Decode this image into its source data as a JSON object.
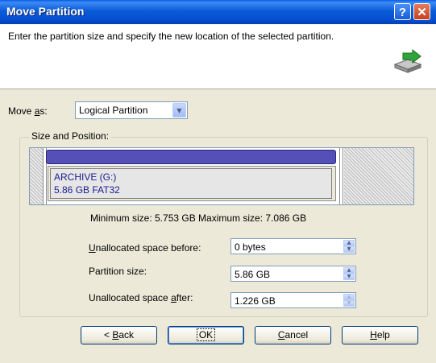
{
  "window": {
    "title": "Move Partition",
    "help_btn": "?",
    "close_btn": "✕"
  },
  "header": {
    "text": "Enter the partition size and specify the new location of the selected partition.",
    "icon": "drive-move-icon"
  },
  "move_as": {
    "label_pre": "Move ",
    "label_u": "a",
    "label_post": "s:",
    "value": "Logical Partition"
  },
  "group": {
    "title": "Size and Position:",
    "partition": {
      "name": "ARCHIVE (G:)",
      "details": "5.86 GB  FAT32",
      "color": "#5550b8"
    }
  },
  "limits": {
    "text": "Minimum size: 5.753 GB   Maximum size: 7.086 GB"
  },
  "fields": [
    {
      "label_u": "U",
      "label_rest": "nallocated space before:",
      "value": "0 bytes"
    },
    {
      "label_u": "",
      "label_rest": "Partition size:",
      "value": "5.86 GB"
    },
    {
      "label_pre": "Unallocated space ",
      "label_u": "a",
      "label_rest": "fter:",
      "value": "1.226 GB"
    }
  ],
  "buttons": {
    "back_pre": "< ",
    "back_u": "B",
    "back_post": "ack",
    "ok": "OK",
    "cancel_u": "C",
    "cancel_post": "ancel",
    "help_u": "H",
    "help_post": "elp"
  }
}
